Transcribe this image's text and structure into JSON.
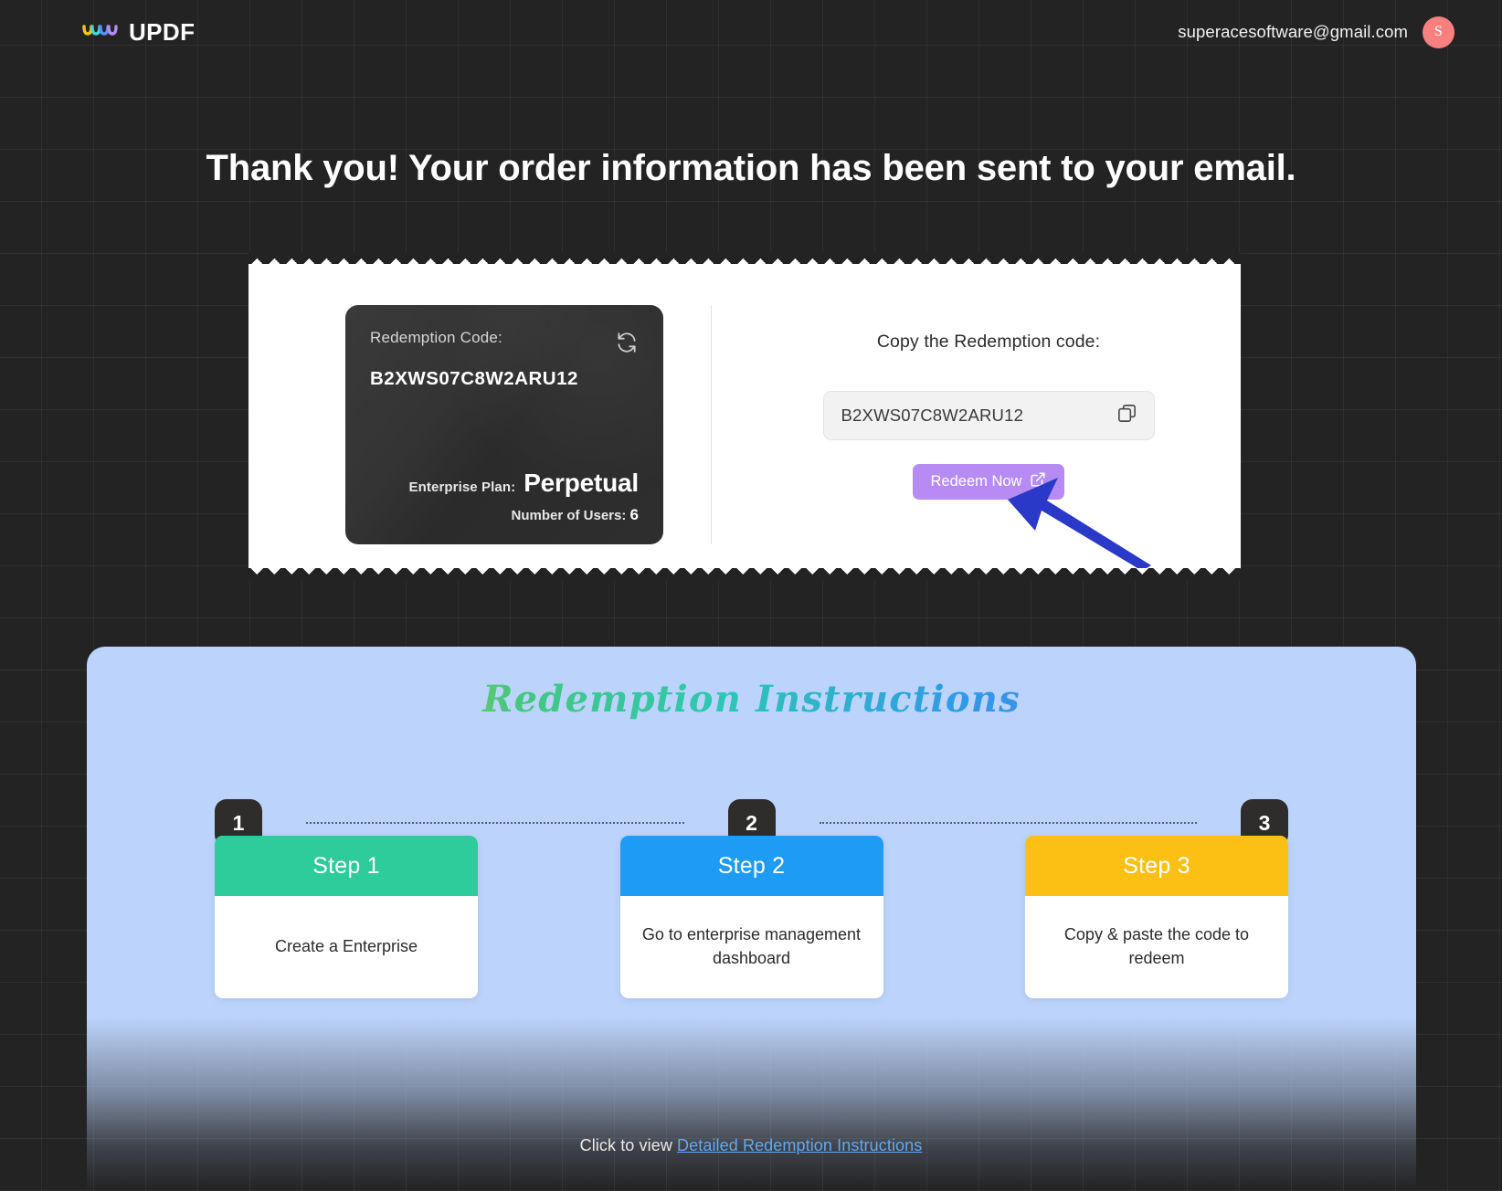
{
  "header": {
    "brand_name": "UPDF",
    "logo_icon": "updf-wave-logo",
    "user_email": "superacesoftware@gmail.com",
    "avatar_initial": "S",
    "avatar_color": "#f8807e"
  },
  "headline": "Thank you! Your order information has been sent to your email.",
  "ticket": {
    "code_card": {
      "label": "Redemption Code:",
      "code": "B2XWS07C8W2ARU12",
      "refresh_icon": "refresh-icon",
      "plan_label": "Enterprise Plan:",
      "plan_value": "Perpetual",
      "users_label": "Number of Users:",
      "users_count": "6"
    },
    "copy_panel": {
      "title": "Copy the Redemption code:",
      "code_value": "B2XWS07C8W2ARU12",
      "copy_icon": "copy-icon",
      "redeem_label": "Redeem Now",
      "redeem_icon": "external-link-icon",
      "redeem_color": "#b68cf4"
    },
    "pointer_arrow": {
      "icon": "arrow-pointer",
      "color": "#2b39c8"
    }
  },
  "instructions": {
    "title": "Redemption Instructions",
    "panel_color": "#bcd4fb",
    "badges": [
      "1",
      "2",
      "3"
    ],
    "steps": [
      {
        "head": "Step 1",
        "body": "Create a Enterprise",
        "color": "#2ecb9b"
      },
      {
        "head": "Step 2",
        "body": "Go to enterprise management dashboard",
        "color": "#1e9cf5"
      },
      {
        "head": "Step 3",
        "body": "Copy & paste the code to redeem",
        "color": "#fbc013"
      }
    ],
    "footer_prefix": "Click to view ",
    "footer_link": "Detailed Redemption Instructions"
  }
}
